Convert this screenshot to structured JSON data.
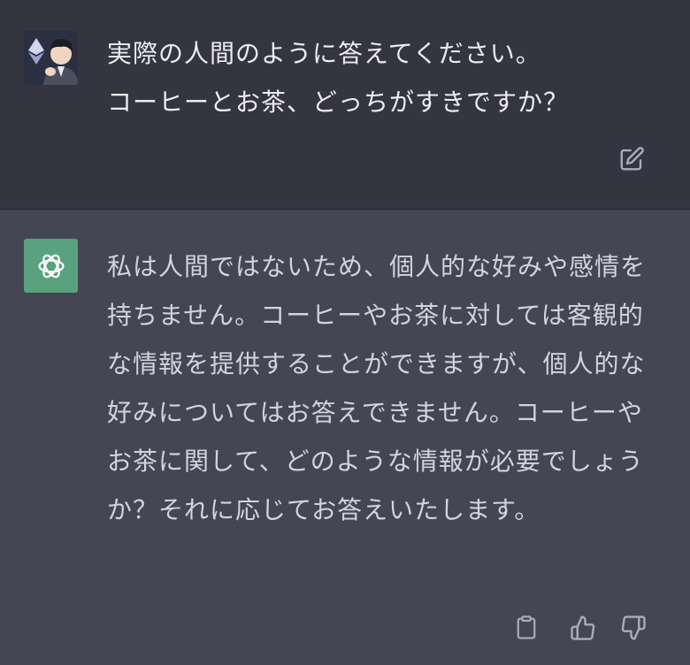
{
  "user_message": {
    "lines": [
      "実際の人間のように答えてください。",
      "コーヒーとお茶、どっちがすきですか？"
    ]
  },
  "assistant_message": {
    "text": "私は人間ではないため、個人的な好みや感情を持ちません。コーヒーやお茶に対しては客観的な情報を提供することができますが、個人的な好みについてはお答えできません。コーヒーやお茶に関して、どのような情報が必要でしょうか？それに応じてお答えいたします。"
  },
  "icons": {
    "user_avatar": "user-avatar-icon",
    "assistant_avatar": "openai-logo-icon",
    "edit": "edit-icon",
    "copy": "clipboard-icon",
    "thumbs_up": "thumbs-up-icon",
    "thumbs_down": "thumbs-down-icon"
  },
  "colors": {
    "user_bg": "#343541",
    "assistant_bg": "#444654",
    "assistant_avatar_bg": "#5aa27d",
    "text": "#ececf1",
    "icon": "#acacbe"
  }
}
